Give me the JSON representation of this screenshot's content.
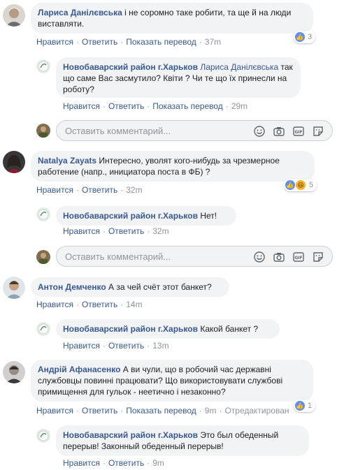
{
  "colors": {
    "link": "#385898",
    "muted": "#90949c",
    "bubble": "#f2f3f5",
    "like": "#5890ff"
  },
  "labels": {
    "like": "Нравится",
    "reply": "Ответить",
    "translate": "Показать перевод",
    "edited": "Отредактирован",
    "placeholder": "Оставить комментарий..."
  },
  "comments": [
    {
      "author": "Лариса Данілєвська",
      "text": "і не соромно таке робити, та ще й на люди виставляти.",
      "time": "37m",
      "reactions": "3",
      "reply": {
        "author": "Новобаварский район г.Харьков",
        "mention": "Лариса Данілєвська",
        "text": "так що саме Вас засмутило? Квіти ? Чи те що їх принесли на роботу?",
        "time": "29m"
      }
    },
    {
      "author": "Natalya Zayats",
      "text": "Интересно, уволят кого-нибудь за чрезмерное работение (напр., инициатора поста в ФБ) ?",
      "time": "32m",
      "reactions": "5",
      "reply": {
        "author": "Новобаварский район г.Харьков",
        "text": "Нет!",
        "time": "32m"
      }
    },
    {
      "author": "Антон Демченко",
      "text": "А за чей счёт этот банкет?",
      "time": "14m",
      "reply": {
        "author": "Новобаварский район г.Харьков",
        "text": "Какой банкет ?",
        "time": "13m"
      }
    },
    {
      "author": "Андрій Афанасенко",
      "text": "А ви чули, що в робочий час державні службовцы повинні працювати? Що використовувати службові примищення для гульок - неетично і незаконно?",
      "time": "9m",
      "reactions": "1",
      "reply": {
        "author": "Новобаварский район г.Харьков",
        "text": "Это был обеденный перерыв! Законный обеденный перерыв!",
        "time": "9m"
      }
    }
  ]
}
